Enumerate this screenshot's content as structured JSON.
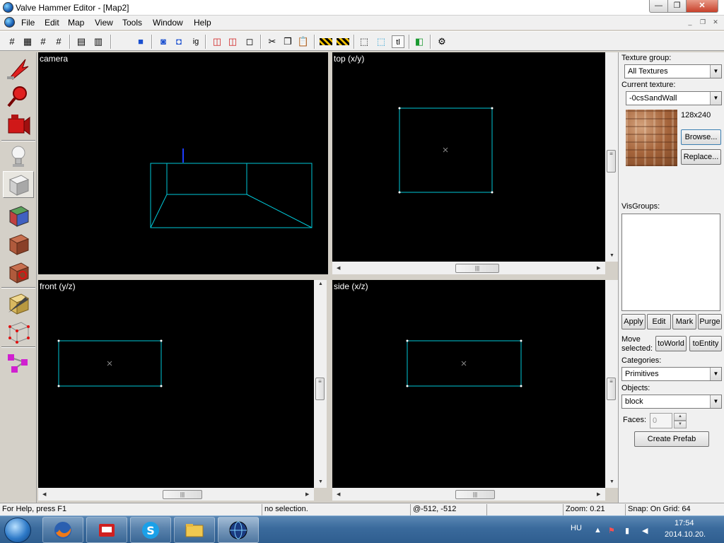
{
  "window": {
    "title": "Valve Hammer Editor - [Map2]",
    "minimize": "—",
    "maximize": "❐",
    "close": "✕"
  },
  "menu": {
    "items": [
      "File",
      "Edit",
      "Map",
      "View",
      "Tools",
      "Window",
      "Help"
    ],
    "mdi_min": "_",
    "mdi_restore": "❐",
    "mdi_close": "✕"
  },
  "viewports": {
    "camera": "camera",
    "top": "top (x/y)",
    "front": "front (y/z)",
    "side": "side (x/z)"
  },
  "right_panel": {
    "texture_group_label": "Texture group:",
    "texture_group_value": "All Textures",
    "current_texture_label": "Current texture:",
    "current_texture_value": "-0csSandWall",
    "texture_size": "128x240",
    "browse": "Browse...",
    "replace": "Replace...",
    "visgroups_label": "VisGroups:",
    "apply": "Apply",
    "edit": "Edit",
    "mark": "Mark",
    "purge": "Purge",
    "move_selected_1": "Move",
    "move_selected_2": "selected:",
    "to_world": "toWorld",
    "to_entity": "toEntity",
    "categories_label": "Categories:",
    "categories_value": "Primitives",
    "objects_label": "Objects:",
    "objects_value": "block",
    "faces_label": "Faces:",
    "faces_value": "0",
    "create_prefab": "Create Prefab"
  },
  "status": {
    "help": "For Help, press F1",
    "selection": "no selection.",
    "coords": "@-512, -512",
    "zoom": "Zoom: 0.21",
    "snap": "Snap: On Grid: 64"
  },
  "taskbar": {
    "language": "HU",
    "time": "17:54",
    "date": "2014.10.20."
  },
  "colors": {
    "wireframe": "#00c8d8",
    "viewport_bg": "#000000",
    "selection_axis": "#1e3cff"
  }
}
